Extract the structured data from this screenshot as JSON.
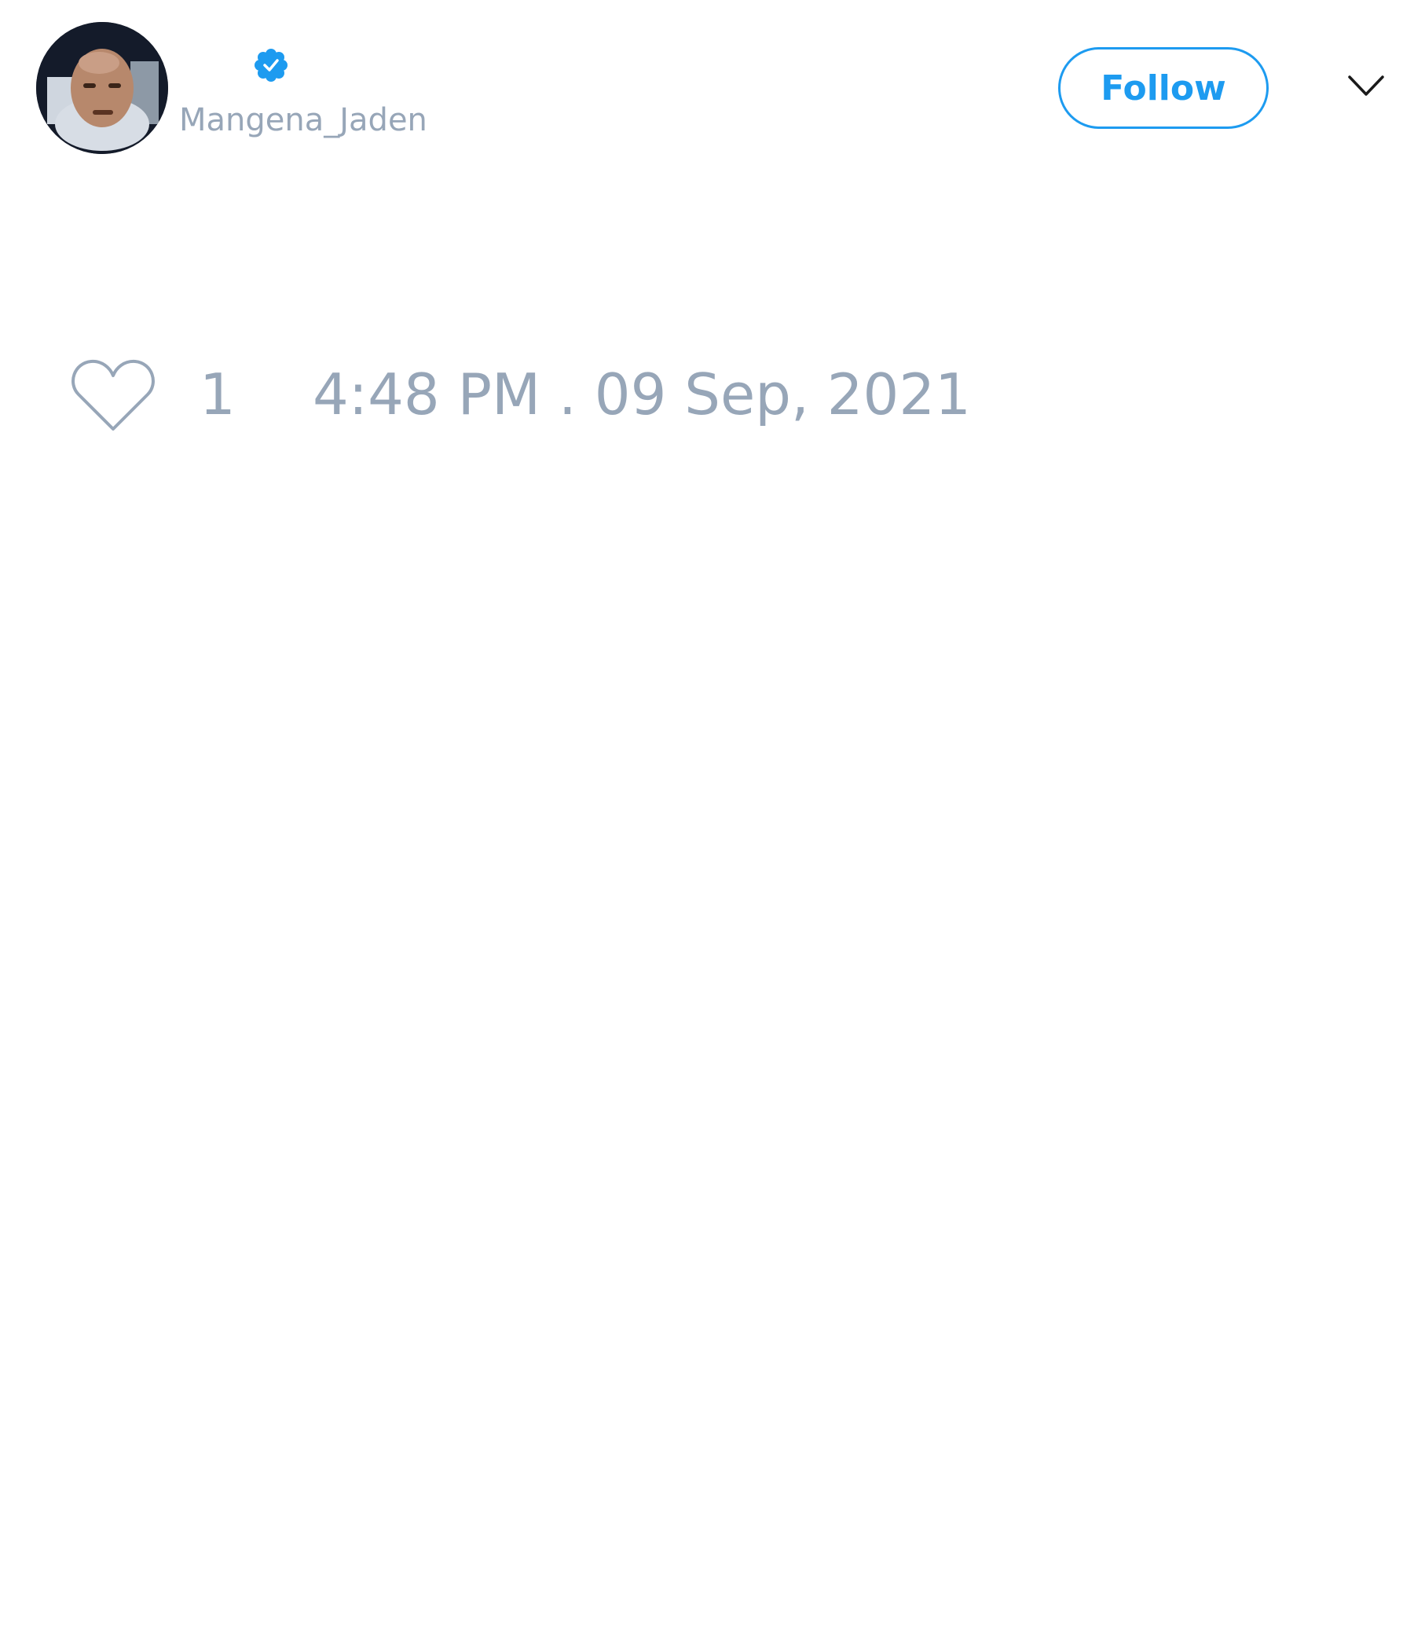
{
  "tweet": {
    "author": {
      "username": "Mangena_Jaden",
      "verified": true,
      "avatar_icon": "profile-photo",
      "verified_icon": "verified-badge-icon"
    },
    "follow_label": "Follow",
    "menu_icon": "chevron-down-icon",
    "like_icon": "heart-outline-icon",
    "like_count": "1",
    "timestamp": "4:48 PM . 09 Sep, 2021"
  },
  "colors": {
    "accent": "#1d9bf0",
    "muted_text": "#97a6b8",
    "background": "#ffffff"
  }
}
